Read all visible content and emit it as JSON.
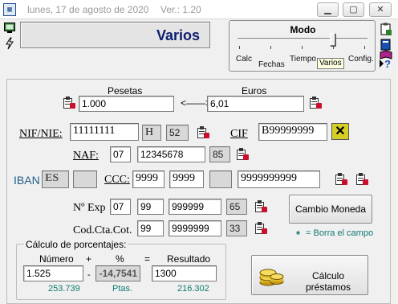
{
  "titlebar": {
    "date": "lunes,  17 de agosto de 2020",
    "version": "Ver.: 1.20",
    "app_icon": "calculator-icon",
    "minimize": "▁",
    "maximize": "▢",
    "close": "✕"
  },
  "header": {
    "title": "Varios"
  },
  "modo": {
    "title": "Modo",
    "labels": [
      "Calc",
      "Fechas",
      "Tiempo",
      "Varios",
      "Config."
    ],
    "selected": "Varios",
    "tooltip": "Varios",
    "level_fraction": 0.75
  },
  "converter": {
    "pesetas_label": "Pesetas",
    "euros_label": "Euros",
    "pesetas_value": "1.000",
    "euros_value": "6,01",
    "arrow": "<——>"
  },
  "nif": {
    "label": "NIF/NIE:",
    "value": "11111111",
    "letter": "H",
    "code": "52",
    "cif_label": "CIF",
    "cif_value": "B99999999"
  },
  "naf": {
    "label": "NAF:",
    "part1": "07",
    "part2": "12345678",
    "control": "85"
  },
  "iban": {
    "label": "IBAN",
    "country": "ES",
    "check": "",
    "ccc_label": "CCC:",
    "entidad": "9999",
    "oficina": "9999",
    "dc": "",
    "cuenta": "9999999999"
  },
  "expediente": {
    "label": "Nº Exp",
    "part1": "07",
    "part2": "99",
    "part3": "999999",
    "control": "65"
  },
  "codcta": {
    "label": "Cod.Cta.Cot.",
    "part1": "99",
    "part2": "9999999",
    "control": "33"
  },
  "buttons": {
    "cambio_moneda": "Cambio Moneda",
    "calculo_prestamos": "Cálculo préstamos"
  },
  "note": {
    "star": "*",
    "text": "= Borra el campo"
  },
  "porcentajes": {
    "group_title": "Cálculo de porcentajes:",
    "numero_label": "Número",
    "percent_label": "%",
    "resultado_label": "Resultado",
    "plus": "+",
    "minus": "-",
    "equals": "=",
    "numero_value": "1.525",
    "percent_value": "-14,7541",
    "resultado_value": "1300",
    "left_total": "253.739",
    "units": "Ptas.",
    "right_total": "216.302"
  },
  "side_icons": {
    "left": [
      "monitor-icon",
      "lightning-icon"
    ],
    "right": [
      "clipboard-icon",
      "notebook-icon",
      "book-icon",
      "help-icon"
    ]
  },
  "colors": {
    "header_title": "#0c1e6e",
    "teal": "#0f7a73",
    "x_button": "#d5cf25",
    "clip_mark": "#c8102e"
  }
}
